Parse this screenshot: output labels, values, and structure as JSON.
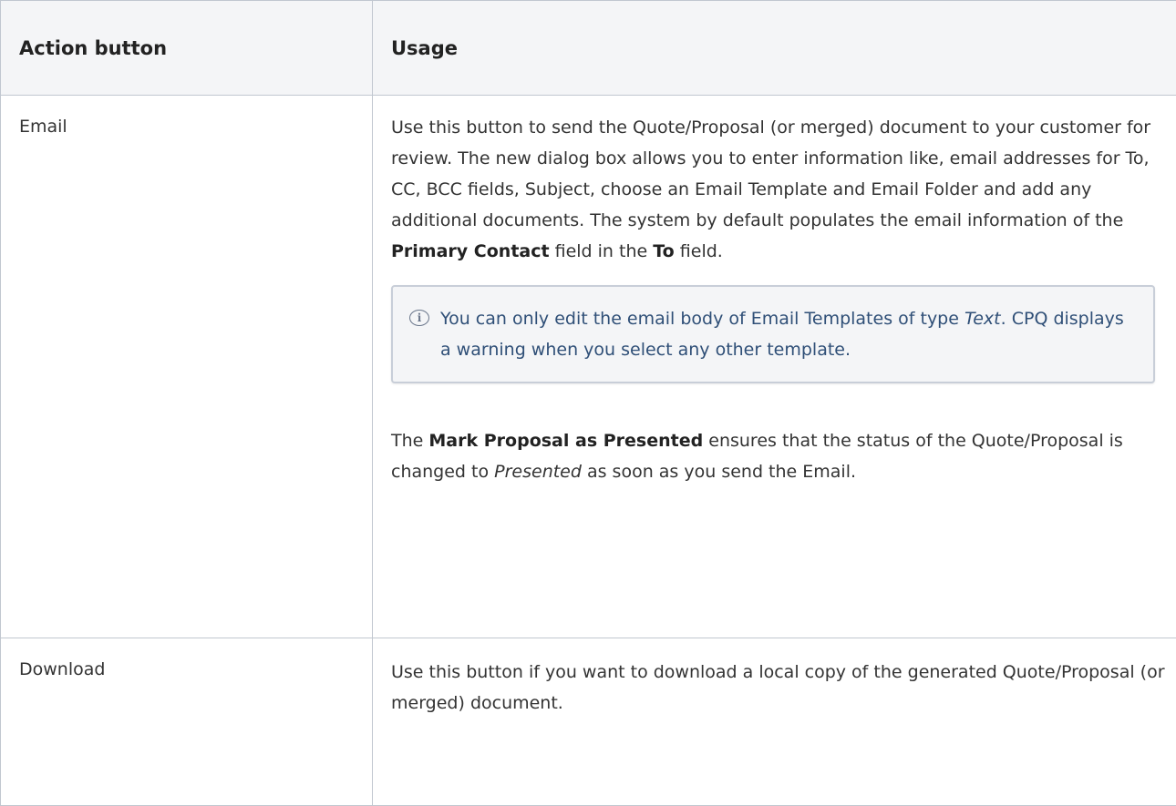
{
  "table": {
    "headers": {
      "action": "Action button",
      "usage": "Usage"
    },
    "rows": [
      {
        "action": "Email",
        "usage_p1": {
          "t1": "Use this button to send the Quote/Proposal (or merged) document to your customer for review. The new dialog box allows you to enter information like, email addresses for To, CC, BCC fields, Subject, choose an Email Template and Email Folder and add any additional documents. The system by default populates the email information of the ",
          "b1": "Primary Contact",
          "t2": " field in the ",
          "b2": "To",
          "t3": " field."
        },
        "info": {
          "t1": "You can only edit the email body of Email Templates of type ",
          "i1": "Text",
          "t2": ". CPQ displays a warning when you select any other template."
        },
        "usage_p2": {
          "t1": "The ",
          "b1": "Mark Proposal as Presented",
          "t2": " ensures that the status of the Quote/Proposal is changed to ",
          "i1": "Presented",
          "t3": " as soon as you send the Email."
        }
      },
      {
        "action": "Download",
        "usage": "Use this button if you want to download a local copy of the generated Quote/Proposal (or merged) document."
      }
    ]
  },
  "icons": {
    "info": "info-icon"
  }
}
